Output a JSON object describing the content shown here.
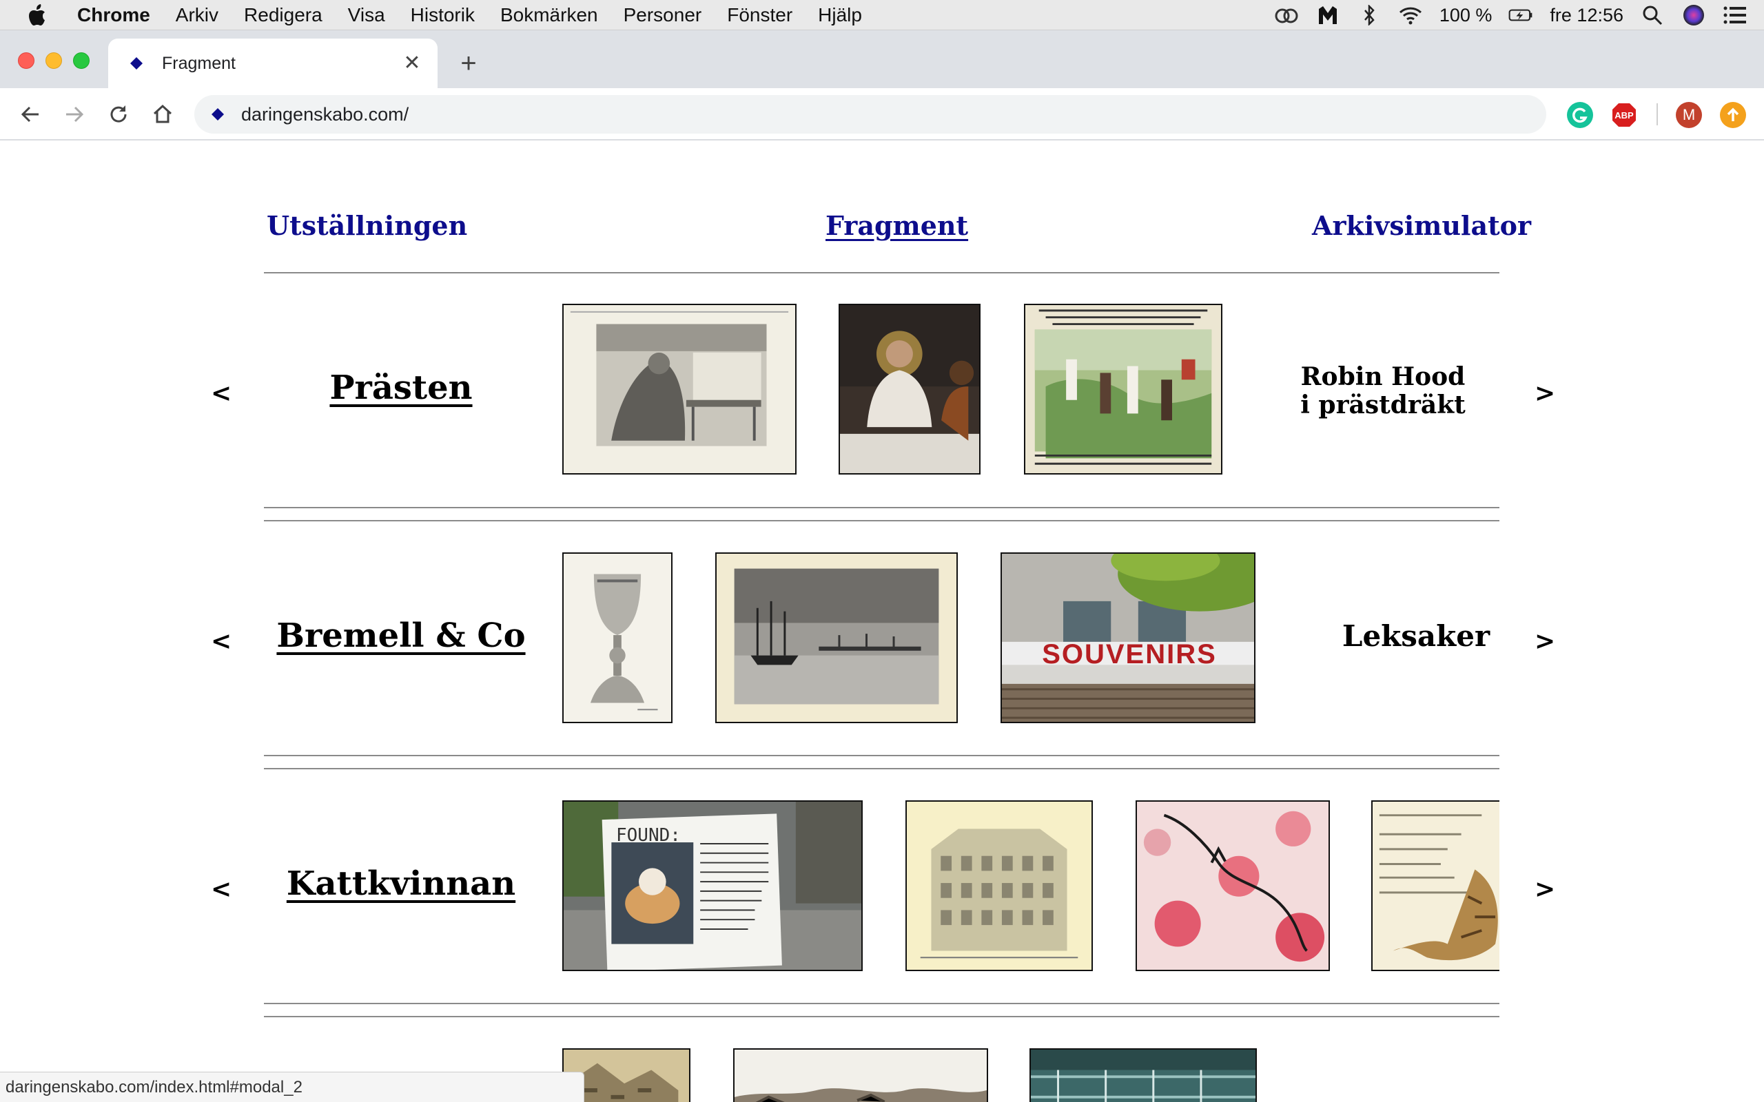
{
  "menubar": {
    "app": "Chrome",
    "items": [
      "Arkiv",
      "Redigera",
      "Visa",
      "Historik",
      "Bokmärken",
      "Personer",
      "Fönster",
      "Hjälp"
    ],
    "battery": "100 %",
    "clock": "fre 12:56"
  },
  "tab": {
    "title": "Fragment",
    "close": "✕",
    "new_tab": "+"
  },
  "toolbar": {
    "url": "daringenskabo.com/",
    "ext_m": "M",
    "ext_abp": "ABP"
  },
  "nav": {
    "left": "Utställningen",
    "center": "Fragment",
    "right": "Arkivsimulator"
  },
  "rows": [
    {
      "title": "Prästen",
      "side_line1": "Robin Hood",
      "side_line2": "i prästdräkt",
      "prev": "<",
      "next": ">"
    },
    {
      "title": "Bremell & Co",
      "side_line1": "Leksaker",
      "prev": "<",
      "next": ">"
    },
    {
      "title": "Kattkvinnan",
      "prev": "<",
      "next": ">"
    }
  ],
  "thumb_texts": {
    "souvenirs": "SOUVENIRS",
    "found": "FOUND:"
  },
  "status_url": "daringenskabo.com/index.html#modal_2",
  "colors": {
    "link": "#0d0d8c",
    "rule": "#8a8a8a",
    "tabstrip": "#dee1e6"
  }
}
